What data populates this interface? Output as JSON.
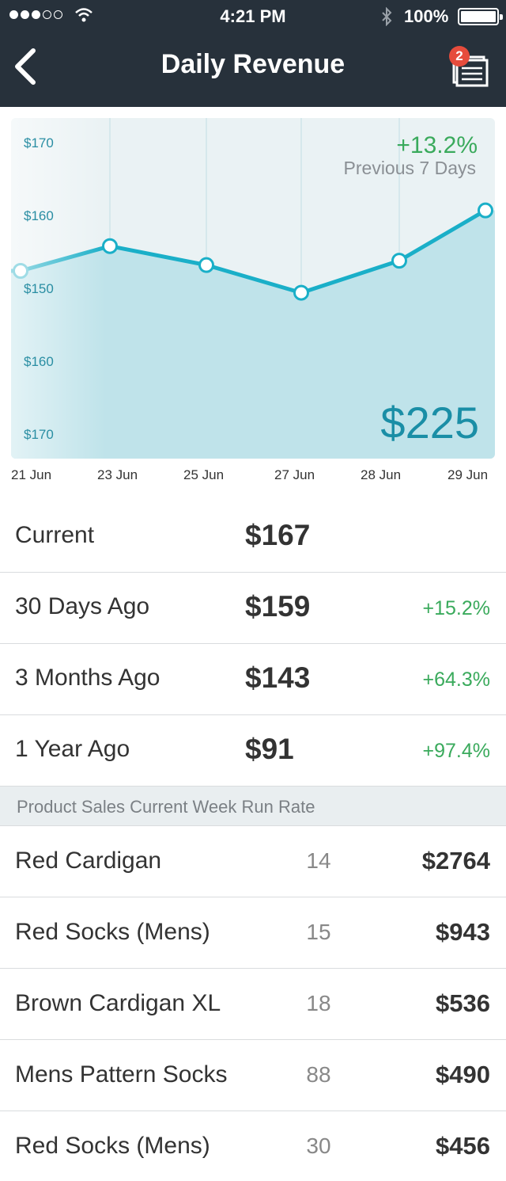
{
  "status": {
    "time": "4:21 PM",
    "battery": "100%"
  },
  "nav": {
    "title": "Daily Revenue",
    "badge_count": "2"
  },
  "chart_data": {
    "type": "area",
    "title": "",
    "summary_change": "+13.2%",
    "summary_period": "Previous 7 Days",
    "big_value": "$225",
    "y_tick_labels": [
      "$170",
      "$160",
      "$150",
      "$160",
      "$170"
    ],
    "x_tick_labels": [
      "21 Jun",
      "23 Jun",
      "25 Jun",
      "27 Jun",
      "28 Jun",
      "29 Jun"
    ],
    "x": [
      "21 Jun",
      "23 Jun",
      "25 Jun",
      "27 Jun",
      "28 Jun",
      "29 Jun"
    ],
    "values": [
      152.5,
      155.9,
      153.3,
      149.5,
      153.9,
      160.8
    ],
    "y_range_top": 170,
    "y_range_step_per_tick": 10,
    "colors": {
      "line": "#1aafc8",
      "area": "#bfe3ea",
      "point_fill": "#ffffff"
    }
  },
  "stats": [
    {
      "label": "Current",
      "value": "$167",
      "change": ""
    },
    {
      "label": "30 Days Ago",
      "value": "$159",
      "change": "+15.2%"
    },
    {
      "label": "3 Months Ago",
      "value": "$143",
      "change": "+64.3%"
    },
    {
      "label": "1 Year Ago",
      "value": "$91",
      "change": "+97.4%"
    }
  ],
  "section_header": "Product Sales Current Week Run Rate",
  "products": [
    {
      "name": "Red Cardigan",
      "qty": "14",
      "amount": "$2764"
    },
    {
      "name": "Red Socks (Mens)",
      "qty": "15",
      "amount": "$943"
    },
    {
      "name": "Brown Cardigan XL",
      "qty": "18",
      "amount": "$536"
    },
    {
      "name": "Mens Pattern Socks",
      "qty": "88",
      "amount": "$490"
    },
    {
      "name": "Red Socks (Mens)",
      "qty": "30",
      "amount": "$456"
    }
  ],
  "icons": {
    "back": "chevron-left-icon",
    "notifications": "stacked-documents-icon",
    "wifi": "wifi-icon",
    "bluetooth": "bluetooth-icon",
    "battery": "battery-icon"
  },
  "colors": {
    "header_bg": "#27313b",
    "positive": "#3aaa5c",
    "accent": "#1a8ea6",
    "badge": "#e64c3c"
  }
}
